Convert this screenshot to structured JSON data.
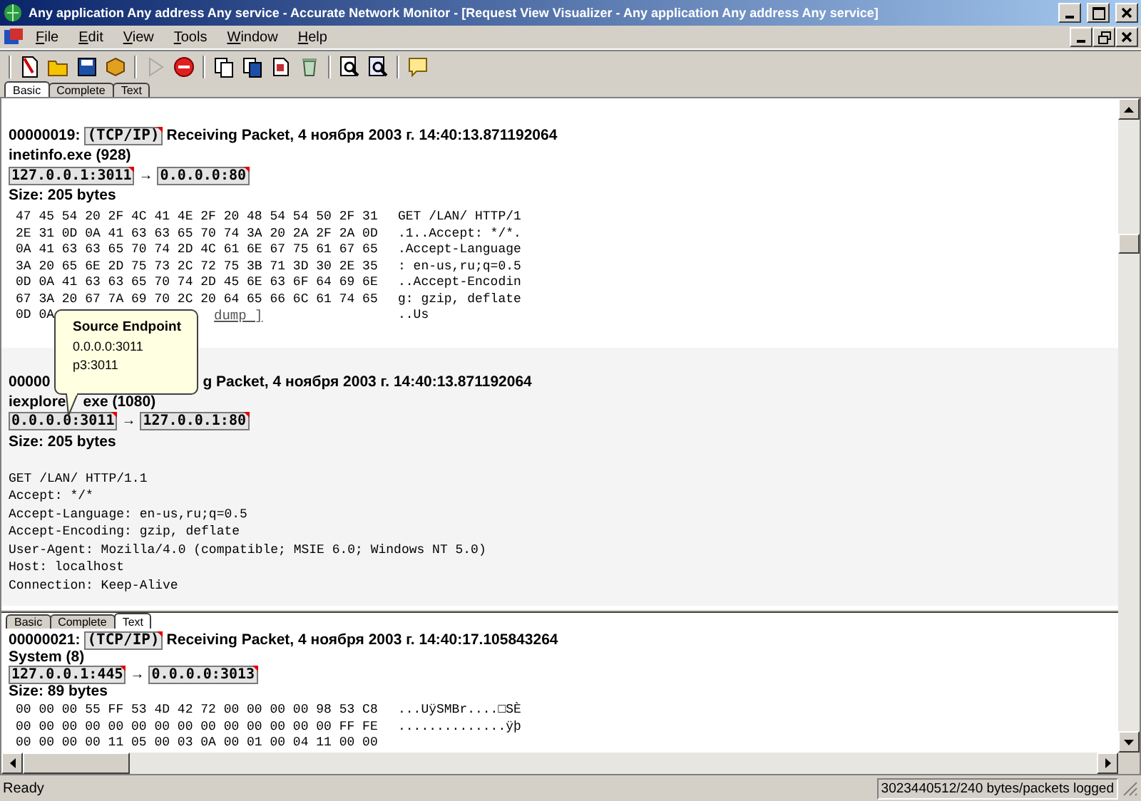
{
  "window": {
    "title": "Any application Any address Any service - Accurate Network Monitor - [Request View Visualizer - Any application Any address Any service]"
  },
  "menu": [
    "File",
    "Edit",
    "View",
    "Tools",
    "Window",
    "Help"
  ],
  "toolbar": [
    [
      {
        "kind": "new",
        "disabled": false
      },
      {
        "kind": "open",
        "disabled": false
      },
      {
        "kind": "save",
        "disabled": false
      },
      {
        "kind": "package",
        "disabled": false
      }
    ],
    [
      {
        "kind": "start",
        "disabled": true
      },
      {
        "kind": "stop",
        "disabled": false
      }
    ],
    [
      {
        "kind": "copy",
        "disabled": false
      },
      {
        "kind": "copy-save",
        "disabled": false
      },
      {
        "kind": "document",
        "disabled": false
      },
      {
        "kind": "trash",
        "disabled": false
      }
    ],
    [
      {
        "kind": "find",
        "disabled": false
      },
      {
        "kind": "find-page",
        "disabled": false
      }
    ],
    [
      {
        "kind": "help",
        "disabled": false
      }
    ]
  ],
  "top_tabs": [
    {
      "label": "Basic",
      "selected": true
    },
    {
      "label": "Complete",
      "selected": false
    },
    {
      "label": "Text",
      "selected": false
    }
  ],
  "packet_19": {
    "id": "00000019:",
    "protocol": "(TCP/IP)",
    "title": "Receiving Packet, 4 ноября 2003 г. 14:40:13.871192064",
    "process": "inetinfo.exe (928)",
    "source": "127.0.0.1:3011",
    "arrow": "→",
    "destination": "0.0.0.0:80",
    "size": "Size: 205 bytes",
    "hex_rows": [
      {
        "hex": "47 45 54 20 2F 4C 41 4E 2F 20 48 54 54 50 2F 31",
        "ascii": "GET /LAN/ HTTP/1"
      },
      {
        "hex": "2E 31 0D 0A 41 63 63 65 70 74 3A 20 2A 2F 2A 0D",
        "ascii": ".1..Accept: */*."
      },
      {
        "hex": "0A 41 63 63 65 70 74 2D 4C 61 6E 67 75 61 67 65",
        "ascii": ".Accept-Language"
      },
      {
        "hex": "3A 20 65 6E 2D 75 73 2C 72 75 3B 71 3D 30 2E 35",
        "ascii": ": en-us,ru;q=0.5"
      },
      {
        "hex": "0D 0A 41 63 63 65 70 74 2D 45 6E 63 6F 64 69 6E",
        "ascii": "..Accept-Encodin"
      },
      {
        "hex": "67 3A 20 67 7A 69 70 2C 20 64 65 66 6C 61 74 65",
        "ascii": "g: gzip, deflate"
      },
      {
        "hex": "0D 0A",
        "ascii": "..Us"
      }
    ],
    "dump_link": "dump ]"
  },
  "packet_20": {
    "id": "00000",
    "title": "g Packet, 4 ноября 2003 г. 14:40:13.871192064",
    "process": "iexplore",
    "process_tail": "exe (1080)",
    "source": "0.0.0.0:3011",
    "arrow": "→",
    "destination": "127.0.0.1:80",
    "size": "Size: 205 bytes",
    "text_lines": [
      "GET /LAN/ HTTP/1.1",
      "Accept: */*",
      "Accept-Language: en-us,ru;q=0.5",
      "Accept-Encoding: gzip, deflate",
      "User-Agent: Mozilla/4.0 (compatible; MSIE 6.0; Windows NT 5.0)",
      "Host: localhost",
      "Connection: Keep-Alive"
    ]
  },
  "tooltip": {
    "title": "Source Endpoint",
    "lines": [
      "0.0.0.0:3011",
      "p3:3011"
    ]
  },
  "bottom_tabs": [
    {
      "label": "Basic",
      "selected": false
    },
    {
      "label": "Complete",
      "selected": false
    },
    {
      "label": "Text",
      "selected": true
    }
  ],
  "packet_21": {
    "id": "00000021:",
    "protocol": "(TCP/IP)",
    "title": "Receiving Packet, 4 ноября 2003 г. 14:40:17.105843264",
    "process": "System (8)",
    "source": "127.0.0.1:445",
    "arrow": "→",
    "destination": "0.0.0.0:3013",
    "size": "Size: 89 bytes",
    "hex_rows": [
      {
        "hex": "00 00 00 55 FF 53 4D 42 72 00 00 00 00 98 53 C8",
        "ascii": "...UÿSMBr....□SÈ"
      },
      {
        "hex": "00 00 00 00 00 00 00 00 00 00 00 00 00 00 FF FE",
        "ascii": "..............ÿþ"
      },
      {
        "hex": "00 00 00 00 11 05 00 03 0A 00 01 00 04 11 00 00",
        "ascii": ""
      }
    ]
  },
  "status_bar": {
    "message": "Ready",
    "counter": "3023440512/240 bytes/packets logged"
  }
}
